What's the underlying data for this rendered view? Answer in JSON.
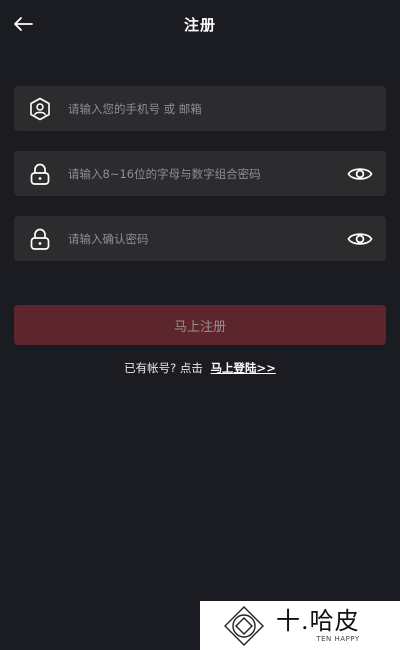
{
  "header": {
    "title": "注册",
    "back_icon": "arrow-left-icon"
  },
  "form": {
    "account": {
      "placeholder": "请输入您的手机号 或 邮箱",
      "value": "",
      "icon": "user-shield-icon"
    },
    "password": {
      "placeholder": "请输入8~16位的字母与数字组合密码",
      "value": "",
      "icon": "lock-icon",
      "toggle_icon": "eye-icon"
    },
    "confirm_password": {
      "placeholder": "请输入确认密码",
      "value": "",
      "icon": "lock-icon",
      "toggle_icon": "eye-icon"
    },
    "submit_label": "马上注册"
  },
  "login_prompt": {
    "text": "已有帐号? 点击",
    "link_label": "马上登陆>>"
  },
  "watermark": {
    "main": "十.哈皮",
    "sub": "TEN HAPPY"
  },
  "colors": {
    "background": "#1b1c22",
    "field_background": "#2c2c2e",
    "button_background": "#5c262c",
    "placeholder": "#8e8e93"
  }
}
